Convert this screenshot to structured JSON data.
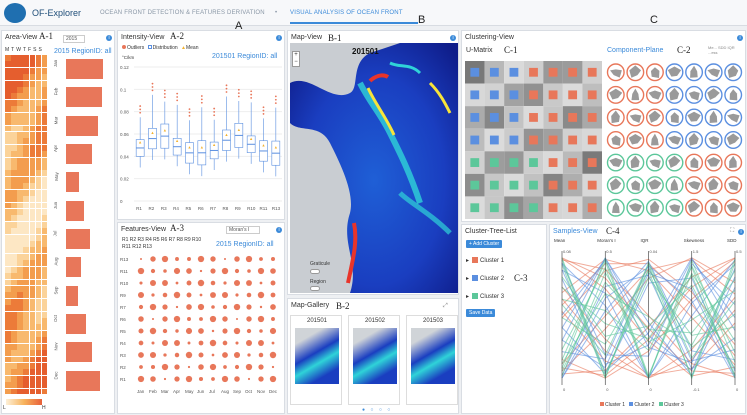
{
  "header": {
    "app_title": "OF-Explorer",
    "nav_tab_1": "OCEAN FRONT DETECTION & FEATURES DERIVATION",
    "nav_separator": "•",
    "nav_tab_2": "VISUAL ANALYSIS OF OCEAN FRONT"
  },
  "section_labels": {
    "A": "A",
    "B": "B",
    "C": "C"
  },
  "area_view": {
    "title": "Area-View",
    "tag": "A-1",
    "year_select": "2015",
    "subtitle": "2015 RegionID: all",
    "weekdays": [
      "M",
      "T",
      "W",
      "T",
      "F",
      "S",
      "S"
    ],
    "months": [
      "Jan",
      "Feb",
      "Mar",
      "Apr",
      "May",
      "Jun",
      "Jul",
      "Aug",
      "Sep",
      "Oct",
      "Nov",
      "Dec"
    ],
    "month_values": [
      0.85,
      0.82,
      0.72,
      0.6,
      0.3,
      0.4,
      0.55,
      0.35,
      0.28,
      0.45,
      0.6,
      0.78
    ],
    "legend_low": "L",
    "legend_high": "H"
  },
  "intensity_view": {
    "title": "Intensity-View",
    "tag": "A-2",
    "legend": [
      "Outliers",
      "Distribution",
      "Mean"
    ],
    "subtitle": "201501 RegionID: all",
    "unit": "°C/km",
    "yticks": [
      "0.12",
      "0.1",
      "0.08",
      "0.06",
      "0.04",
      "0.02",
      "0"
    ],
    "regions": [
      "R1",
      "R2",
      "R3",
      "R4",
      "R5",
      "R6",
      "R7",
      "R8",
      "R9",
      "R10",
      "R11",
      "R13"
    ]
  },
  "features_view": {
    "title": "Features-View",
    "tag": "A-3",
    "select": "Moran's I",
    "region_list": "R1 R2 R3 R4 R5 R6 R7 R8 R9 R10 R11 R12 R13",
    "subtitle": "2015 RegionID: all",
    "rows": [
      "R13",
      "R11",
      "R10",
      "R9",
      "R7",
      "R6",
      "R5",
      "R4",
      "R3",
      "R2",
      "R1"
    ],
    "months": [
      "Jan",
      "Feb",
      "Mar",
      "Apr",
      "May",
      "Jun",
      "Jul",
      "Aug",
      "Sep",
      "Oct",
      "Nov",
      "Dec"
    ]
  },
  "map_view": {
    "title": "Map-View",
    "tag": "B-1",
    "date": "201501",
    "graticule_label": "Graticule",
    "region_label": "Region",
    "zoom_in": "+",
    "zoom_out": "−"
  },
  "map_gallery": {
    "title": "Map-Gallery",
    "tag": "B-2",
    "thumbnails": [
      "201501",
      "201502",
      "201503"
    ]
  },
  "clustering_view": {
    "title": "Clustering-View",
    "umatrix_label": "U-Matrix",
    "tag_umatrix": "C-1",
    "component_label": "Component-Plane",
    "tag_component": "C-2",
    "component_hint": "Me... SDD IQR ...ess"
  },
  "cluster_tree": {
    "title": "Cluster-Tree-List",
    "tag": "C-3",
    "add_button": "+ Add Cluster",
    "save_button": "Save Data",
    "clusters": [
      {
        "label": "Cluster 1",
        "color": "#e8775a"
      },
      {
        "label": "Cluster 2",
        "color": "#5b8fe0"
      },
      {
        "label": "Cluster 3",
        "color": "#5cc79a"
      }
    ]
  },
  "samples_view": {
    "title": "Samples-View",
    "tag": "C-4",
    "axes": [
      "Mean",
      "Moran's I",
      "IQR",
      "Skewness",
      "SDD"
    ],
    "axis_top": [
      "0.08",
      "0.5",
      "0.04",
      "1.5",
      "0.5"
    ],
    "axis_bottom": [
      "0",
      "0",
      "0",
      "-0.1",
      "0"
    ],
    "legend": [
      "Cluster 1",
      "Cluster 2",
      "Cluster 3"
    ]
  },
  "colors": {
    "accent": "#3b8ad9",
    "cluster1": "#e8775a",
    "cluster2": "#5b8fe0",
    "cluster3": "#5cc79a"
  }
}
